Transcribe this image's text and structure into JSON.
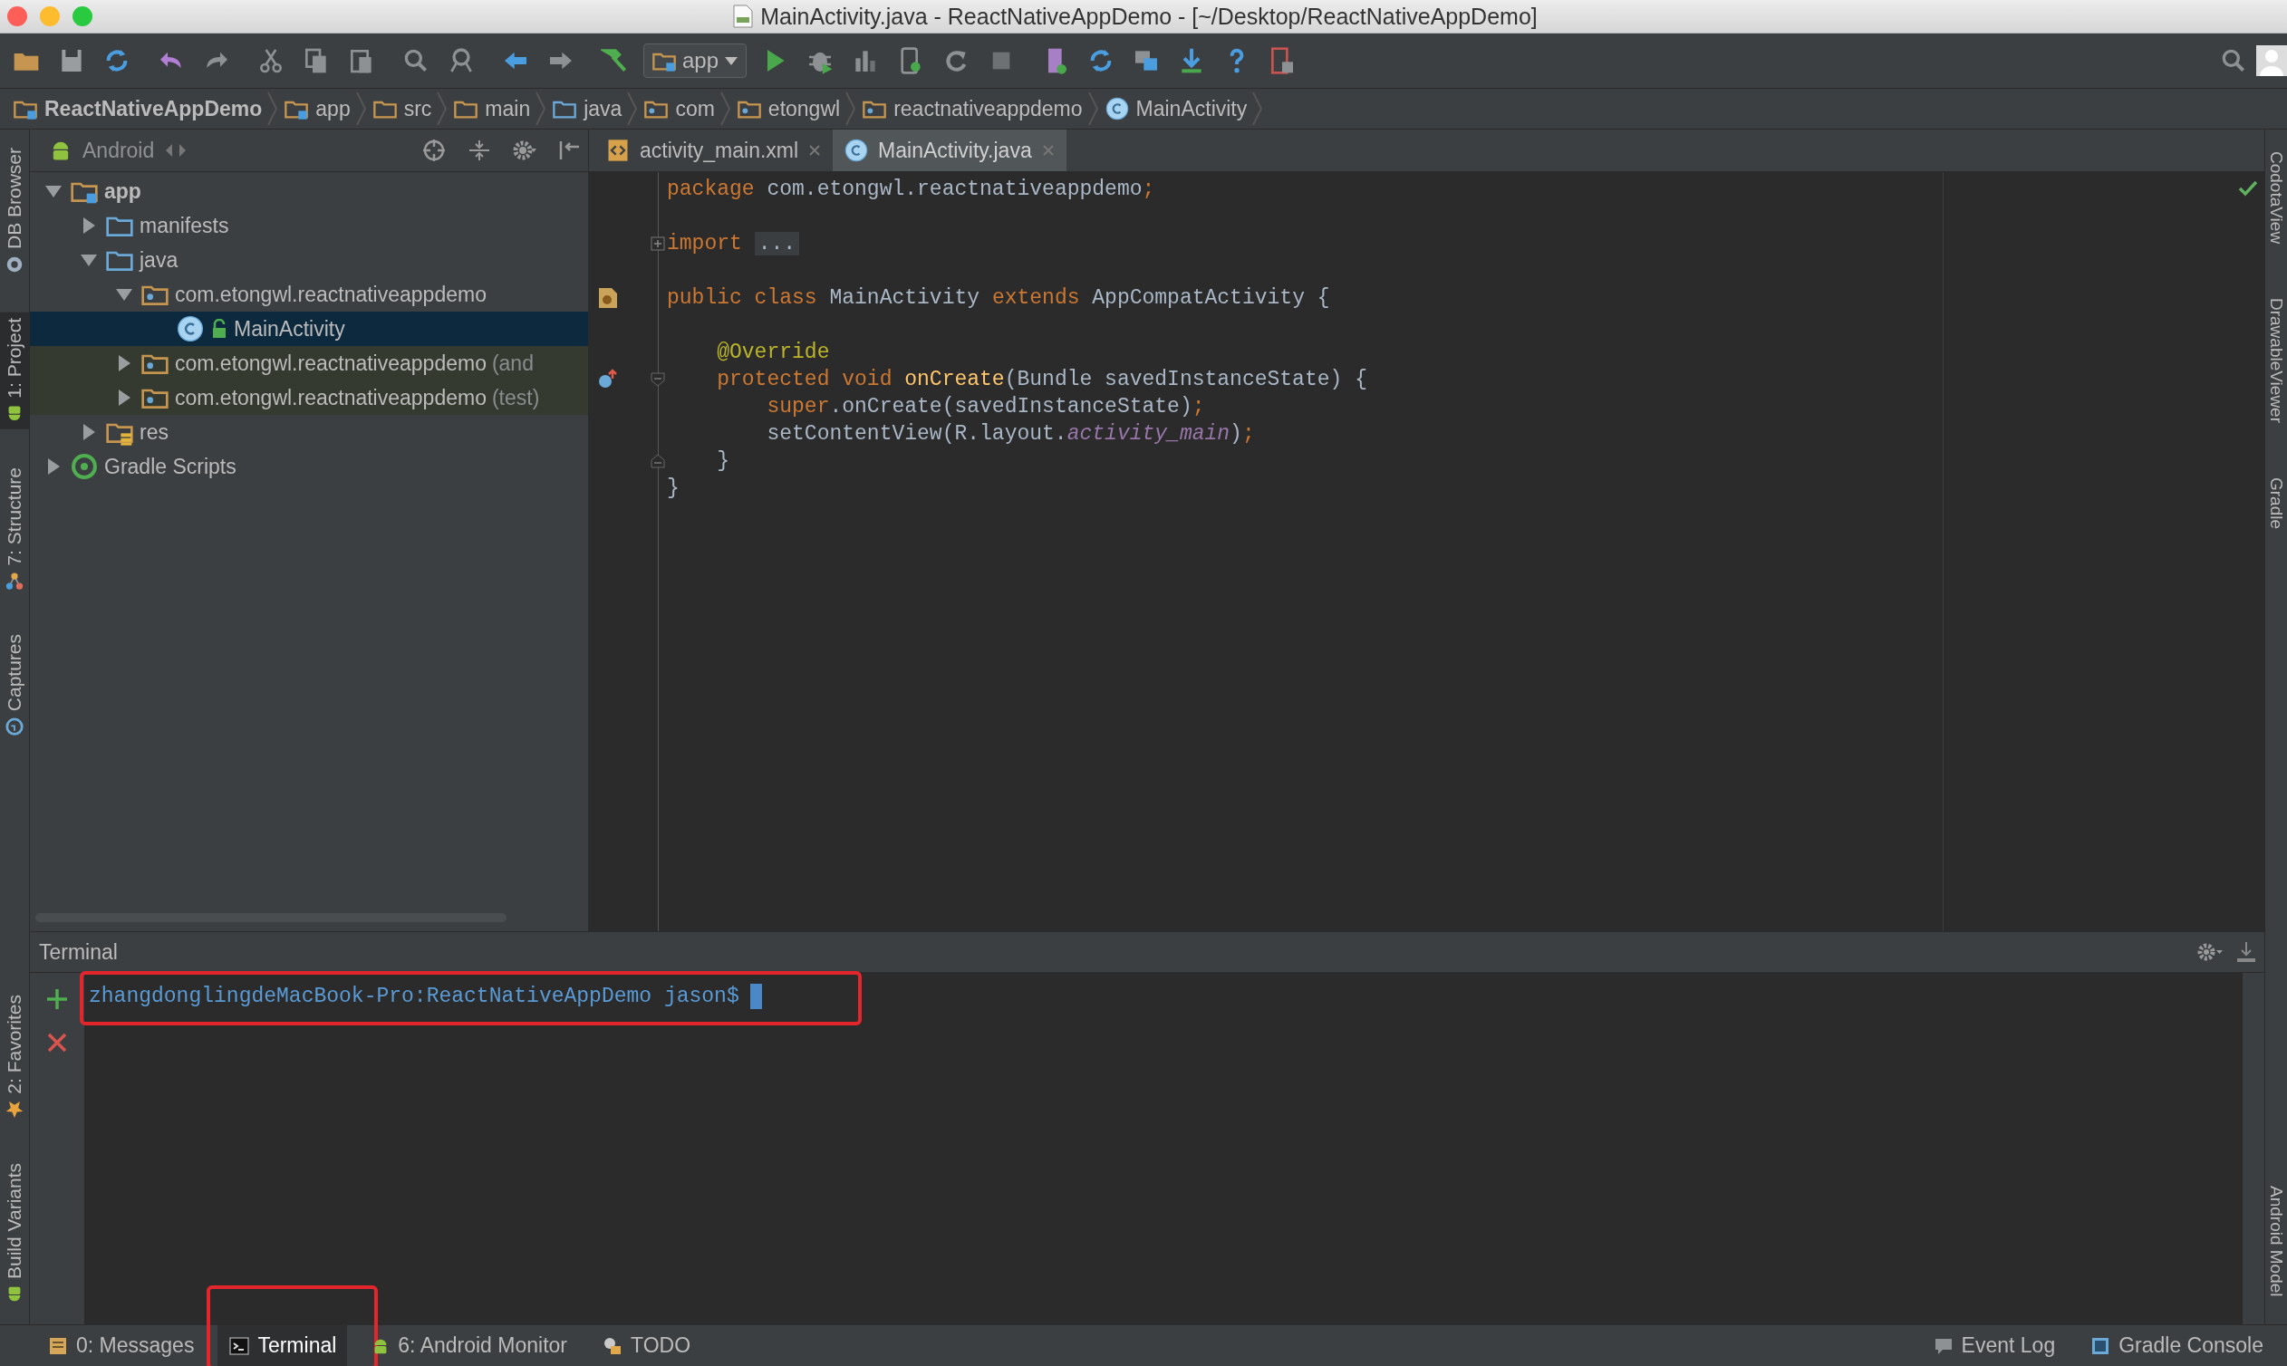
{
  "window": {
    "title": "MainActivity.java - ReactNativeAppDemo - [~/Desktop/ReactNativeAppDemo]"
  },
  "toolbar": {
    "run_config": "app"
  },
  "breadcrumbs": [
    {
      "label": "ReactNativeAppDemo",
      "kind": "module"
    },
    {
      "label": "app",
      "kind": "module"
    },
    {
      "label": "src",
      "kind": "folder"
    },
    {
      "label": "main",
      "kind": "folder"
    },
    {
      "label": "java",
      "kind": "source"
    },
    {
      "label": "com",
      "kind": "package"
    },
    {
      "label": "etongwl",
      "kind": "package"
    },
    {
      "label": "reactnativeappdemo",
      "kind": "package"
    },
    {
      "label": "MainActivity",
      "kind": "class"
    }
  ],
  "left_tool_windows": [
    {
      "label": "DB Browser",
      "kind": "db",
      "selected": false
    },
    {
      "label": "1: Project",
      "kind": "android",
      "selected": true
    },
    {
      "label": "7: Structure",
      "kind": "structure",
      "selected": false
    },
    {
      "label": "Captures",
      "kind": "captures",
      "selected": false
    },
    {
      "label": "2: Favorites",
      "kind": "favorites",
      "selected": false
    },
    {
      "label": "Build Variants",
      "kind": "android",
      "selected": false
    }
  ],
  "project": {
    "view": "Android",
    "tree": [
      {
        "label": "app",
        "kind": "module",
        "expanded": true,
        "selected": false,
        "children": [
          {
            "label": "manifests",
            "kind": "source",
            "expanded": false,
            "selected": false
          },
          {
            "label": "java",
            "kind": "source",
            "expanded": true,
            "selected": false,
            "children": [
              {
                "label": "com.etongwl.reactnativeappdemo",
                "kind": "package",
                "expanded": true,
                "selected": false,
                "children": [
                  {
                    "label": "MainActivity",
                    "kind": "class",
                    "selected": true
                  }
                ]
              },
              {
                "label": "com.etongwl.reactnativeappdemo",
                "suffix": "(and",
                "kind": "package",
                "expanded": false,
                "selected": false,
                "test": true
              },
              {
                "label": "com.etongwl.reactnativeappdemo",
                "suffix": "(test)",
                "kind": "package",
                "expanded": false,
                "selected": false,
                "test": true
              }
            ]
          },
          {
            "label": "res",
            "kind": "res",
            "expanded": false,
            "selected": false
          }
        ]
      },
      {
        "label": "Gradle Scripts",
        "kind": "gradle",
        "expanded": false,
        "selected": false
      }
    ]
  },
  "editor": {
    "tabs": [
      {
        "label": "activity_main.xml",
        "kind": "xml",
        "selected": false
      },
      {
        "label": "MainActivity.java",
        "kind": "class",
        "selected": true
      }
    ],
    "lines": [
      {
        "kind": "code",
        "tokens": [
          {
            "text": "package",
            "kind": "keyword"
          },
          {
            "text": " com.etongwl.reactnativeappdemo",
            "kind": "plain"
          },
          {
            "text": ";",
            "kind": "keyword"
          }
        ]
      },
      {
        "kind": "blank"
      },
      {
        "kind": "code",
        "folded": true,
        "tokens": [
          {
            "text": "import ",
            "kind": "keyword"
          },
          {
            "text": "...",
            "kind": "folded"
          }
        ]
      },
      {
        "kind": "blank"
      },
      {
        "kind": "code",
        "class_marker": true,
        "tokens": [
          {
            "text": "public class ",
            "kind": "keyword"
          },
          {
            "text": "MainActivity ",
            "kind": "plain"
          },
          {
            "text": "extends ",
            "kind": "keyword"
          },
          {
            "text": "AppCompatActivity {",
            "kind": "plain"
          }
        ]
      },
      {
        "kind": "blank"
      },
      {
        "kind": "code",
        "tokens": [
          {
            "text": "    @Override",
            "kind": "annotation"
          }
        ]
      },
      {
        "kind": "code",
        "override_marker": true,
        "fold_start": true,
        "tokens": [
          {
            "text": "    protected void ",
            "kind": "keyword"
          },
          {
            "text": "onCreate",
            "kind": "method"
          },
          {
            "text": "(Bundle savedInstanceState) {",
            "kind": "plain"
          }
        ]
      },
      {
        "kind": "code",
        "tokens": [
          {
            "text": "        super",
            "kind": "keyword"
          },
          {
            "text": ".onCreate(savedInstanceState)",
            "kind": "plain"
          },
          {
            "text": ";",
            "kind": "keyword"
          }
        ]
      },
      {
        "kind": "code",
        "tokens": [
          {
            "text": "        setContentView(R.layout.",
            "kind": "plain"
          },
          {
            "text": "activity_main",
            "kind": "field"
          },
          {
            "text": ")",
            "kind": "plain"
          },
          {
            "text": ";",
            "kind": "keyword"
          }
        ]
      },
      {
        "kind": "code",
        "fold_end": true,
        "tokens": [
          {
            "text": "    }",
            "kind": "plain"
          }
        ]
      },
      {
        "kind": "code",
        "tokens": [
          {
            "text": "}",
            "kind": "plain"
          }
        ]
      }
    ]
  },
  "right_tool_windows": [
    {
      "label": "CodotaView"
    },
    {
      "label": "DrawableViewer"
    },
    {
      "label": "Gradle"
    },
    {
      "label": "Android Model"
    }
  ],
  "terminal": {
    "title": "Terminal",
    "prompt": "zhangdonglingdeMacBook-Pro:ReactNativeAppDemo jason$",
    "highlighted": true
  },
  "bottom_tabs": [
    {
      "label": "0: Messages",
      "kind": "messages",
      "selected": false,
      "highlighted": false
    },
    {
      "label": "Terminal",
      "kind": "terminal",
      "selected": true,
      "highlighted": true
    },
    {
      "label": "6: Android Monitor",
      "kind": "android",
      "selected": false,
      "highlighted": false
    },
    {
      "label": "TODO",
      "kind": "todo",
      "selected": false,
      "highlighted": false
    }
  ],
  "right_bottom_tabs": [
    {
      "label": "Event Log",
      "kind": "log"
    },
    {
      "label": "Gradle Console",
      "kind": "console"
    }
  ]
}
